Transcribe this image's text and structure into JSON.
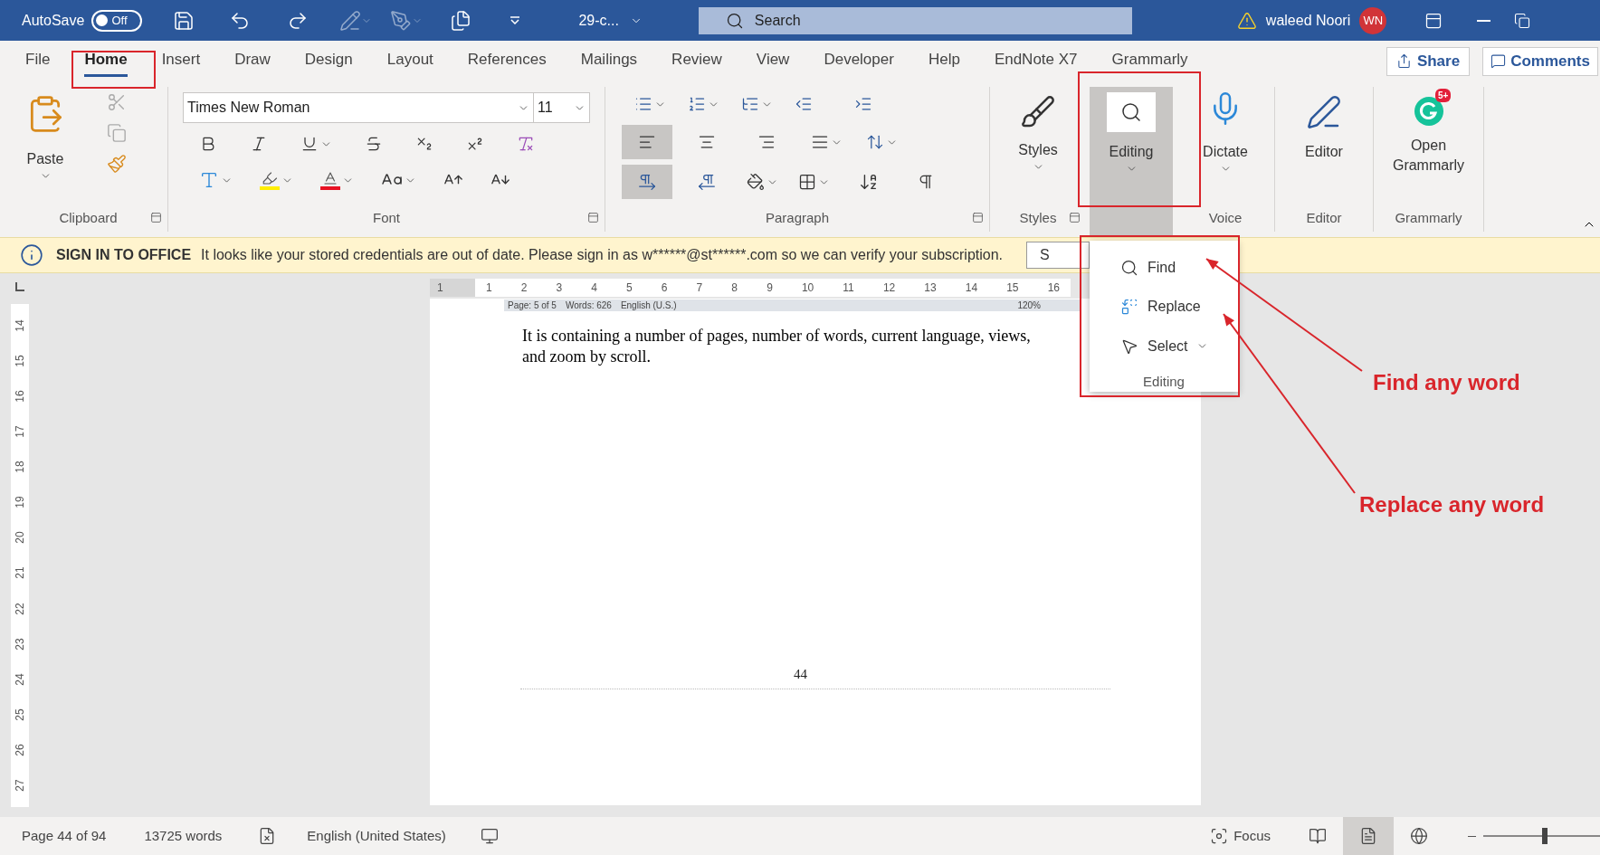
{
  "title_bar": {
    "autosave": {
      "label": "AutoSave",
      "toggle_label": "Off",
      "on": false
    },
    "document_title": "29-c...",
    "search_placeholder": "Search",
    "user_name": "waleed Noori",
    "user_initials": "WN"
  },
  "tabs": [
    {
      "label": "File",
      "selected": false
    },
    {
      "label": "Home",
      "selected": true
    },
    {
      "label": "Insert",
      "selected": false
    },
    {
      "label": "Draw",
      "selected": false
    },
    {
      "label": "Design",
      "selected": false
    },
    {
      "label": "Layout",
      "selected": false
    },
    {
      "label": "References",
      "selected": false
    },
    {
      "label": "Mailings",
      "selected": false
    },
    {
      "label": "Review",
      "selected": false
    },
    {
      "label": "View",
      "selected": false
    },
    {
      "label": "Developer",
      "selected": false
    },
    {
      "label": "Help",
      "selected": false
    },
    {
      "label": "EndNote X7",
      "selected": false
    },
    {
      "label": "Grammarly",
      "selected": false
    }
  ],
  "share_label": "Share",
  "comments_label": "Comments",
  "ribbon": {
    "clipboard": {
      "paste_label": "Paste",
      "group_label": "Clipboard"
    },
    "font": {
      "font_name": "Times New Roman",
      "font_size": "11",
      "group_label": "Font"
    },
    "paragraph": {
      "alignments": [
        {
          "kind": "left",
          "selected": true
        },
        {
          "kind": "center",
          "selected": false
        },
        {
          "kind": "right",
          "selected": false
        },
        {
          "kind": "justify",
          "selected": false
        }
      ],
      "directions": [
        {
          "kind": "ltr",
          "selected": true
        },
        {
          "kind": "rtl",
          "selected": false
        }
      ],
      "group_label": "Paragraph"
    },
    "styles": {
      "button_label": "Styles",
      "group_label": "Styles"
    },
    "editing": {
      "button_label": "Editing",
      "expanded": true
    },
    "voice": {
      "button_label": "Dictate",
      "group_label": "Voice"
    },
    "editor": {
      "button_label": "Editor",
      "group_label": "Editor"
    },
    "grammarly": {
      "button_label": "Open Grammarly",
      "badge": "5+",
      "group_label": "Grammarly"
    }
  },
  "info_bar": {
    "title": "SIGN IN TO OFFICE",
    "message": "It looks like your stored credentials are out of date. Please sign in as w******@st******.com so we can verify your subscription.",
    "button_label": "S"
  },
  "ruler": {
    "horizontal": [
      "1",
      "1",
      "2",
      "3",
      "4",
      "5",
      "6",
      "7",
      "8",
      "9",
      "10",
      "11",
      "12",
      "13",
      "14",
      "15",
      "16"
    ],
    "vertical": [
      "14",
      "15",
      "16",
      "17",
      "18",
      "19",
      "20",
      "21",
      "22",
      "23",
      "24",
      "25",
      "26",
      "27"
    ]
  },
  "document": {
    "embedded_status": [
      "Page: 5 of 5",
      "Words: 626",
      "English (U.S.)",
      "120%"
    ],
    "paragraph": "It is containing a number of pages, number of words, current language, views, and zoom by scroll.",
    "page_number": "44"
  },
  "editing_menu": {
    "items": [
      {
        "kind": "find",
        "label": "Find"
      },
      {
        "kind": "replace",
        "label": "Replace"
      },
      {
        "kind": "select",
        "label": "Select"
      }
    ],
    "group_label": "Editing"
  },
  "highlights": [
    {
      "kind": "home_tab"
    },
    {
      "kind": "editing_button"
    },
    {
      "kind": "editing_menu"
    }
  ],
  "annotations": [
    {
      "kind": "find",
      "text": "Find any word"
    },
    {
      "kind": "replace",
      "text": "Replace any word"
    }
  ],
  "status_bar": {
    "page": "Page 44 of 94",
    "words": "13725 words",
    "language": "English (United States)",
    "focus_label": "Focus",
    "views": [
      {
        "kind": "read",
        "selected": false
      },
      {
        "kind": "print",
        "selected": true
      },
      {
        "kind": "web",
        "selected": false
      }
    ],
    "zoom": {
      "level": 0.5
    }
  }
}
